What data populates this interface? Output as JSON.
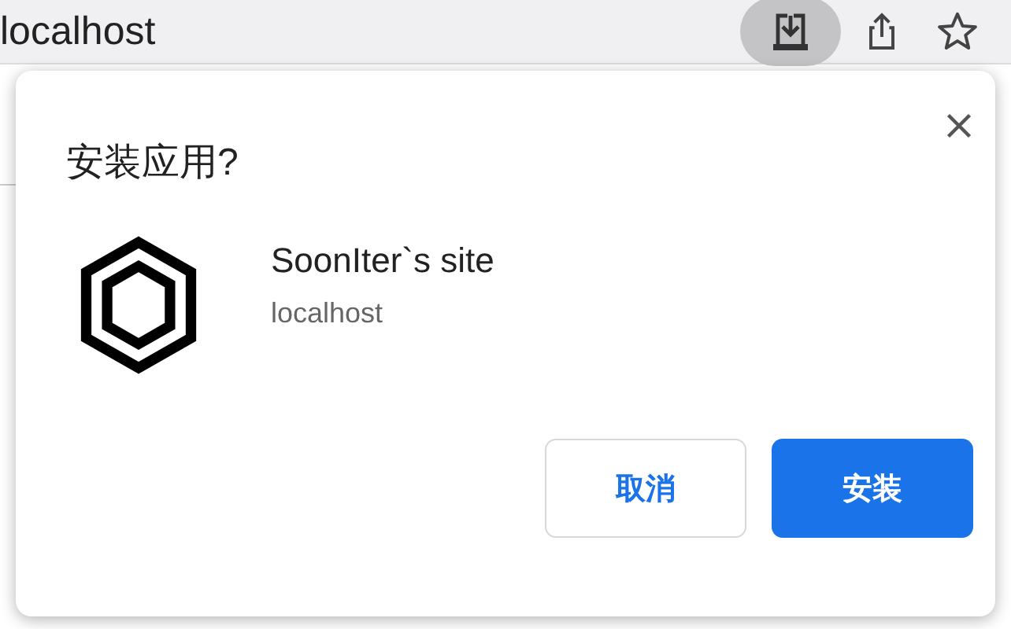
{
  "address_bar": {
    "url": "localhost",
    "install_active": true
  },
  "dialog": {
    "title": "安装应用?",
    "app_name": "SoonIter`s site",
    "app_origin": "localhost",
    "buttons": [
      {
        "label": "取消",
        "kind": "secondary"
      },
      {
        "label": "安装",
        "kind": "primary"
      }
    ]
  }
}
